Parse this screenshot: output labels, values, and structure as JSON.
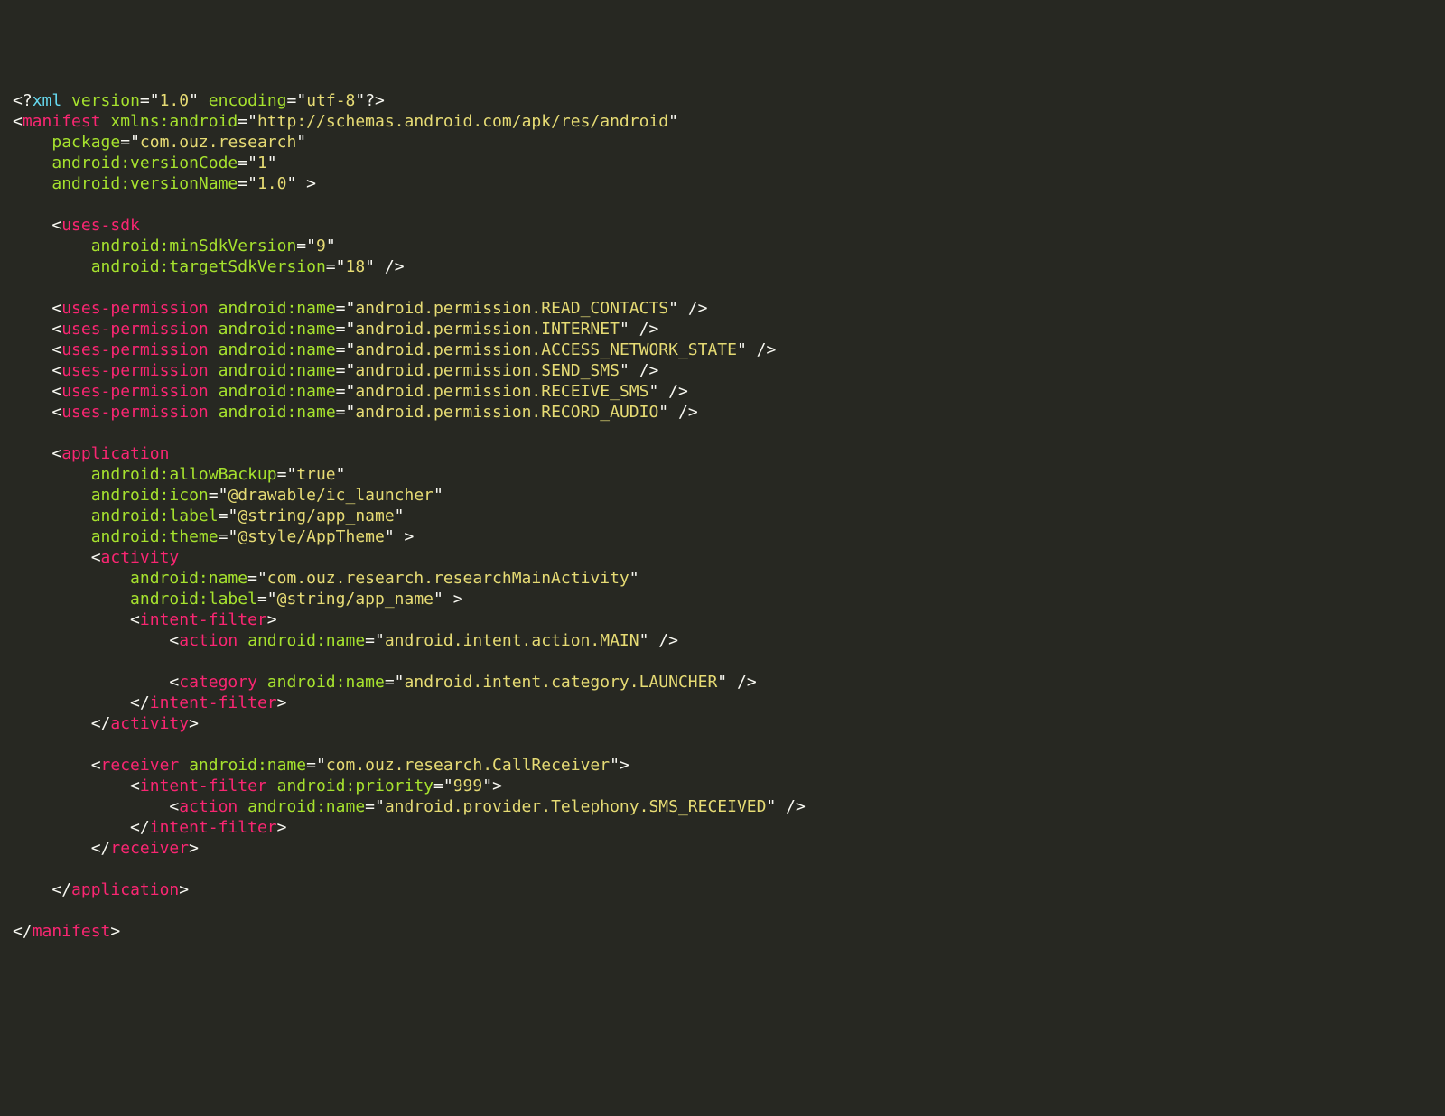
{
  "decl": {
    "elem": "xml",
    "attrs": [
      [
        "version",
        "1.0"
      ],
      [
        "encoding",
        "utf-8"
      ]
    ]
  },
  "manifest": {
    "elem": "manifest",
    "attrs": [
      [
        "xmlns:android",
        "http://schemas.android.com/apk/res/android"
      ],
      [
        "package",
        "com.ouz.research"
      ],
      [
        "android:versionCode",
        "1"
      ],
      [
        "android:versionName",
        "1.0"
      ]
    ]
  },
  "usesSdk": {
    "elem": "uses-sdk",
    "attrs": [
      [
        "android:minSdkVersion",
        "9"
      ],
      [
        "android:targetSdkVersion",
        "18"
      ]
    ]
  },
  "permissions": [
    "android.permission.READ_CONTACTS",
    "android.permission.INTERNET",
    "android.permission.ACCESS_NETWORK_STATE",
    "android.permission.SEND_SMS",
    "android.permission.RECEIVE_SMS",
    "android.permission.RECORD_AUDIO"
  ],
  "permAttr": "android:name",
  "permElem": "uses-permission",
  "application": {
    "elem": "application",
    "attrs": [
      [
        "android:allowBackup",
        "true"
      ],
      [
        "android:icon",
        "@drawable/ic_launcher"
      ],
      [
        "android:label",
        "@string/app_name"
      ],
      [
        "android:theme",
        "@style/AppTheme"
      ]
    ],
    "activity": {
      "elem": "activity",
      "attrs": [
        [
          "android:name",
          "com.ouz.research.researchMainActivity"
        ],
        [
          "android:label",
          "@string/app_name"
        ]
      ],
      "intentFilter": {
        "elem": "intent-filter",
        "action": {
          "elem": "action",
          "attr": [
            "android:name",
            "android.intent.action.MAIN"
          ]
        },
        "category": {
          "elem": "category",
          "attr": [
            "android:name",
            "android.intent.category.LAUNCHER"
          ]
        }
      }
    },
    "receiver": {
      "elem": "receiver",
      "attr": [
        "android:name",
        "com.ouz.research.CallReceiver"
      ],
      "intentFilter": {
        "elem": "intent-filter",
        "attr": [
          "android:priority",
          "999"
        ],
        "action": {
          "elem": "action",
          "attr": [
            "android:name",
            "android.provider.Telephony.SMS_RECEIVED"
          ]
        }
      }
    }
  }
}
